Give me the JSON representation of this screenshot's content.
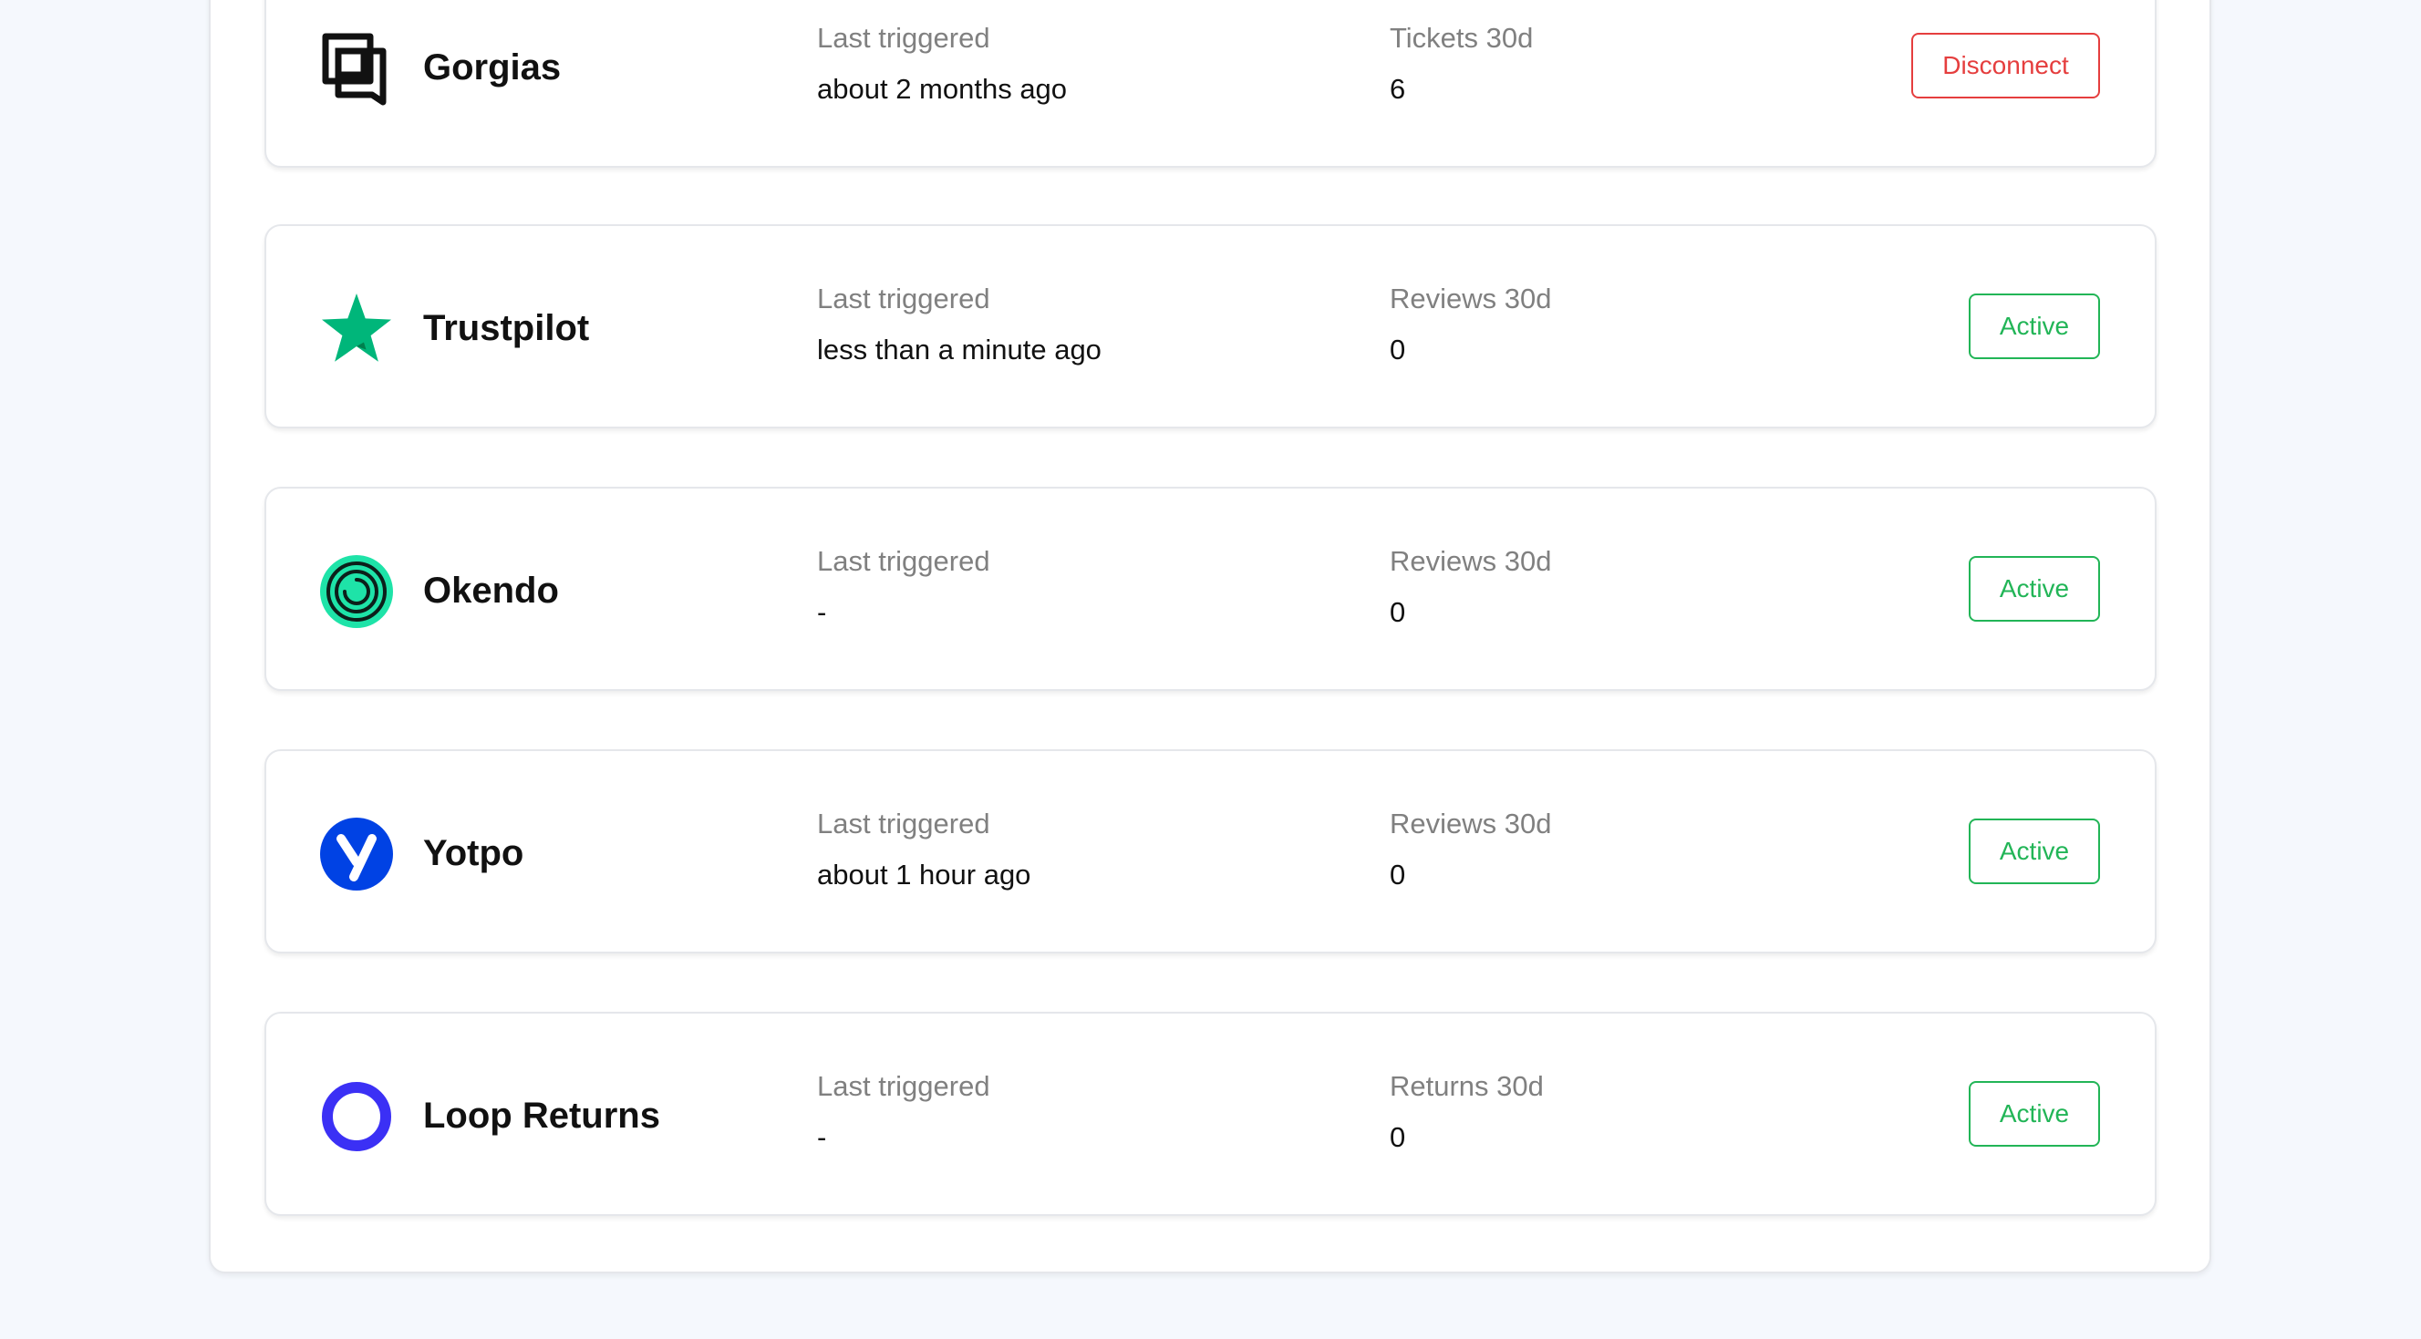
{
  "colors": {
    "active": "#22b557",
    "disconnect": "#e53e3e",
    "label": "#808080",
    "background": "#f5f8fd"
  },
  "integrations": [
    {
      "name": "Gorgias",
      "icon": "gorgias-logo-icon",
      "stat1_label": "Last triggered",
      "stat1_value": "about 2 months ago",
      "stat2_label": "Tickets 30d",
      "stat2_value": "6",
      "action_label": "Disconnect",
      "action_style": "disconnect"
    },
    {
      "name": "Trustpilot",
      "icon": "trustpilot-star-icon",
      "stat1_label": "Last triggered",
      "stat1_value": "less than a minute ago",
      "stat2_label": "Reviews 30d",
      "stat2_value": "0",
      "action_label": "Active",
      "action_style": "active"
    },
    {
      "name": "Okendo",
      "icon": "okendo-logo-icon",
      "stat1_label": "Last triggered",
      "stat1_value": "-",
      "stat2_label": "Reviews 30d",
      "stat2_value": "0",
      "action_label": "Active",
      "action_style": "active"
    },
    {
      "name": "Yotpo",
      "icon": "yotpo-logo-icon",
      "stat1_label": "Last triggered",
      "stat1_value": "about 1 hour ago",
      "stat2_label": "Reviews 30d",
      "stat2_value": "0",
      "action_label": "Active",
      "action_style": "active"
    },
    {
      "name": "Loop Returns",
      "icon": "loop-returns-ring-icon",
      "stat1_label": "Last triggered",
      "stat1_value": "-",
      "stat2_label": "Returns 30d",
      "stat2_value": "0",
      "action_label": "Active",
      "action_style": "active"
    }
  ]
}
